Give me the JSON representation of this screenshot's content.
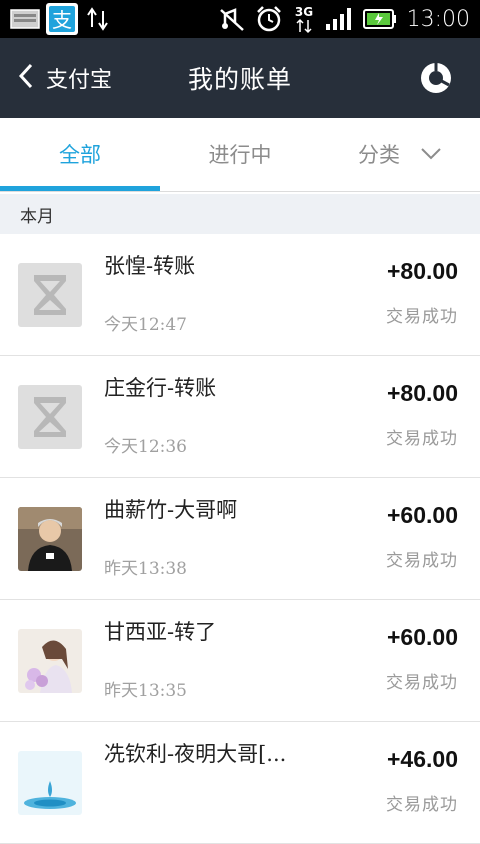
{
  "status_bar": {
    "time": "13:00",
    "network": "3G",
    "icons": [
      "message-icon",
      "alipay-icon",
      "usb-icon",
      "mute-icon",
      "alarm-icon",
      "3g-icon",
      "signal-icon",
      "battery-icon"
    ],
    "colors": {
      "battery": "#5ac83c",
      "alipay": "#1fa3dc"
    }
  },
  "header": {
    "back_label": "支付宝",
    "title": "我的账单",
    "chart_icon": "pie-chart-icon"
  },
  "tabs": [
    {
      "label": "全部",
      "active": true
    },
    {
      "label": "进行中",
      "active": false
    },
    {
      "label": "分类",
      "active": false
    }
  ],
  "section": {
    "label": "本月"
  },
  "transactions": [
    {
      "name": "张惶-转账",
      "time": "今天12:47",
      "amount": "+80.00",
      "status": "交易成功",
      "avatar": "hourglass-placeholder"
    },
    {
      "name": "庄金行-转账",
      "time": "今天12:36",
      "amount": "+80.00",
      "status": "交易成功",
      "avatar": "hourglass-placeholder"
    },
    {
      "name": "曲薪竹-大哥啊",
      "time": "昨天13:38",
      "amount": "+60.00",
      "status": "交易成功",
      "avatar": "photo-man"
    },
    {
      "name": "甘西亚-转了",
      "time": "昨天13:35",
      "amount": "+60.00",
      "status": "交易成功",
      "avatar": "photo-woman-flowers"
    },
    {
      "name": "冼钦利-夜明大哥[...",
      "time": "",
      "amount": "+46.00",
      "status": "交易成功",
      "avatar": "photo-water-drop"
    }
  ],
  "colors": {
    "accent": "#1fa3dc",
    "titlebar": "#272f3a",
    "section_bg": "#eef1f5"
  }
}
